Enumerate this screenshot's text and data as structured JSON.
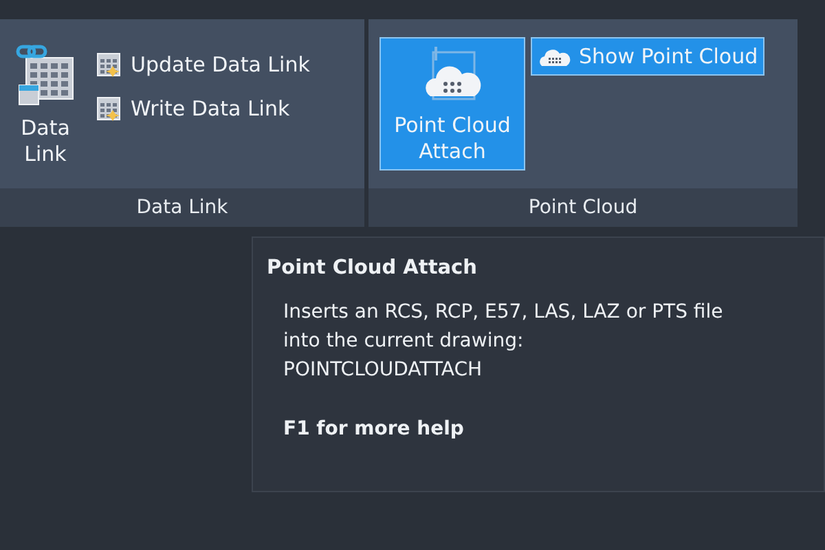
{
  "ribbon": {
    "panels": [
      {
        "title": "Data Link",
        "large_button": {
          "label": "Data\nLink",
          "selected": false
        },
        "small_buttons": [
          {
            "label": "Update Data Link",
            "selected": false
          },
          {
            "label": "Write Data Link",
            "selected": false
          }
        ]
      },
      {
        "title": "Point Cloud",
        "large_button": {
          "label": "Point Cloud\nAttach",
          "selected": true
        },
        "small_buttons": [
          {
            "label": "Show Point Cloud",
            "selected": true
          }
        ]
      }
    ]
  },
  "tooltip": {
    "title": "Point Cloud Attach",
    "description": "Inserts an RCS, RCP, E57, LAS, LAZ or PTS file\ninto the current drawing:",
    "command": "POINTCLOUDATTACH",
    "help": "F1 for more help"
  }
}
